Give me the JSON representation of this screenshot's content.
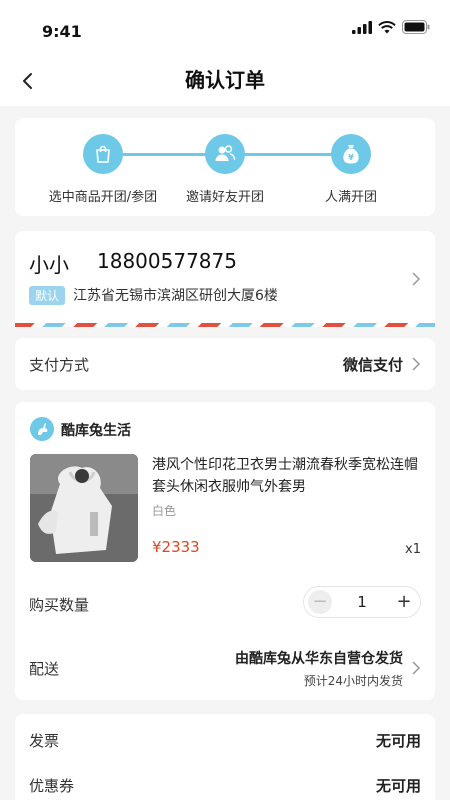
{
  "status": {
    "time": "9:41"
  },
  "nav": {
    "title": "确认订单"
  },
  "steps": [
    {
      "label": "选中商品开团/参团",
      "icon": "bag-icon"
    },
    {
      "label": "邀请好友开团",
      "icon": "users-icon"
    },
    {
      "label": "人满开团",
      "icon": "money-bag-icon"
    }
  ],
  "address": {
    "name": "小小",
    "phone": "18800577875",
    "tag": "默认",
    "line": "江苏省无锡市滨湖区研创大厦6楼"
  },
  "payment": {
    "label": "支付方式",
    "value": "微信支付"
  },
  "shop": {
    "name": "酷库兔生活"
  },
  "product": {
    "title": "港风个性印花卫衣男士潮流春秋季宽松连帽套头休闲衣服帅气外套男",
    "spec": "白色",
    "price": "¥2333",
    "qty": "x1"
  },
  "quantity": {
    "label": "购买数量",
    "value": "1",
    "minus": "−",
    "plus": "+"
  },
  "delivery": {
    "label": "配送",
    "main": "由酷库兔从华东自营仓发货",
    "sub": "预计24小时内发货"
  },
  "invoice": {
    "label": "发票",
    "value": "无可用"
  },
  "coupon": {
    "label": "优惠券",
    "value": "无可用"
  },
  "colors": {
    "accent": "#6ec8e8",
    "price": "#e0451f"
  }
}
